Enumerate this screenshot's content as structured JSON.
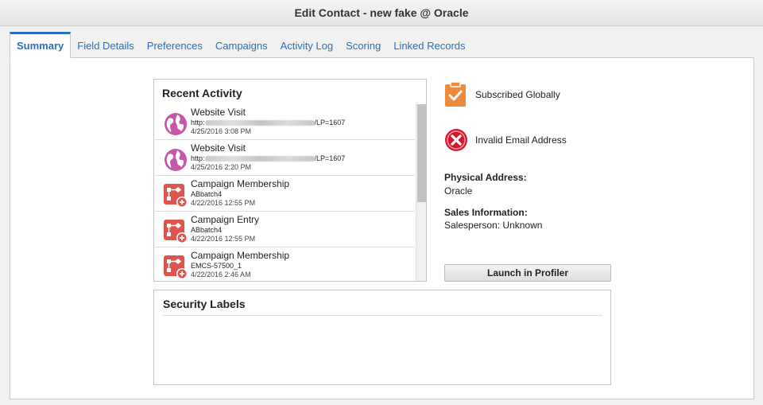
{
  "window": {
    "title": "Edit Contact - new fake @ Oracle"
  },
  "tabs": [
    {
      "label": "Summary",
      "active": true
    },
    {
      "label": "Field Details"
    },
    {
      "label": "Preferences"
    },
    {
      "label": "Campaigns"
    },
    {
      "label": "Activity Log"
    },
    {
      "label": "Scoring"
    },
    {
      "label": "Linked Records"
    }
  ],
  "recent_activity": {
    "title": "Recent Activity",
    "items": [
      {
        "type": "Website Visit",
        "icon": "globe-icon",
        "detail_prefix": "http:",
        "detail_suffix": "/LP=1607",
        "date": "4/25/2016 3:08 PM"
      },
      {
        "type": "Website Visit",
        "icon": "globe-icon",
        "detail_prefix": "http:",
        "detail_suffix": "/LP=1607",
        "date": "4/25/2016 2:20 PM"
      },
      {
        "type": "Campaign Membership",
        "icon": "campaign-icon",
        "detail": "ABbatch4",
        "date": "4/22/2016 12:55 PM"
      },
      {
        "type": "Campaign Entry",
        "icon": "campaign-icon",
        "detail": "ABbatch4",
        "date": "4/22/2016 12:55 PM"
      },
      {
        "type": "Campaign Membership",
        "icon": "campaign-icon",
        "detail": "EMCS-57500_1",
        "date": "4/22/2016 2:46 AM"
      }
    ]
  },
  "status": {
    "subscription": "Subscribed Globally",
    "email": "Invalid Email Address"
  },
  "physical_address": {
    "label": "Physical Address:",
    "value": "Oracle"
  },
  "sales_information": {
    "label": "Sales Information:",
    "value": "Salesperson: Unknown"
  },
  "actions": {
    "launch_profiler": "Launch in Profiler"
  },
  "security_labels": {
    "title": "Security Labels"
  },
  "colors": {
    "accent": "#2a6ebb",
    "globe": "#c758a8",
    "campaign": "#e0544e",
    "subscribed": "#ef8a3a",
    "invalid": "#d8152a"
  }
}
